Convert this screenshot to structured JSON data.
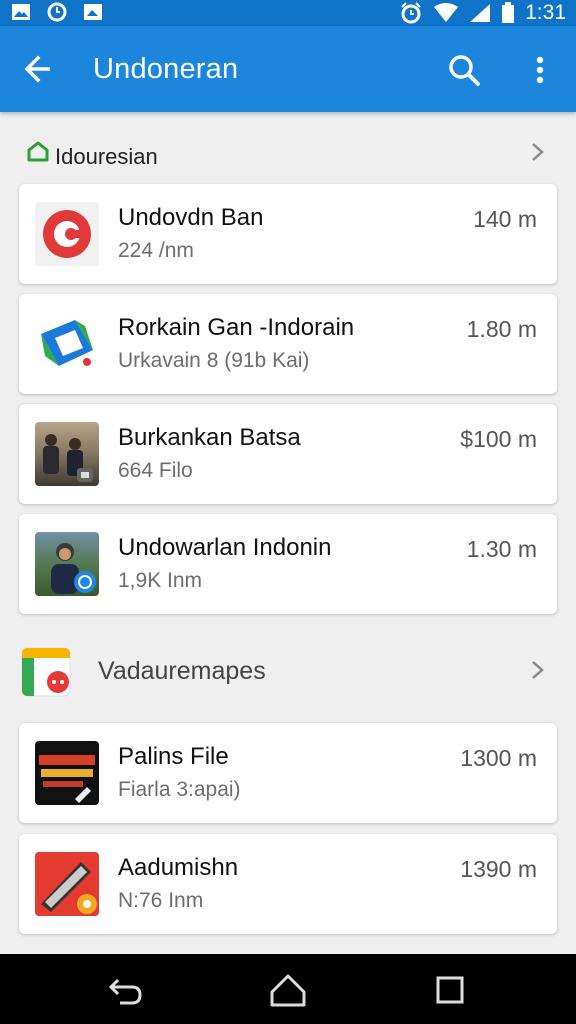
{
  "status_bar": {
    "time": "1:31",
    "left_icons": [
      "image-icon",
      "alarm-icon",
      "photo-icon"
    ],
    "right_icons": [
      "alarm-clock-icon",
      "wifi-icon",
      "signal-icon",
      "battery-icon"
    ]
  },
  "app_bar": {
    "title": "Undoneran",
    "back_icon": "arrow-back-icon",
    "search_icon": "search-icon",
    "more_icon": "more-vert-icon",
    "color": "#1b86dc"
  },
  "section1": {
    "label": "Idouresian",
    "icon": "home-icon"
  },
  "items": [
    {
      "title": "Undovdn Ban",
      "subtitle": "224 /nm",
      "distance": "140 m"
    },
    {
      "title": "Rorkain Gan -Indorain",
      "subtitle": "Urkavain 8 (91b Kai)",
      "distance": "1.80 m"
    },
    {
      "title": "Burkankan Batsa",
      "subtitle": "664 Filo",
      "distance": "$100 m"
    },
    {
      "title": "Undowarlan Indonin",
      "subtitle": "1,9K Inm",
      "distance": "1.30 m"
    }
  ],
  "section2": {
    "label": "Vadauremapes",
    "icon": "maps-icon"
  },
  "items2": [
    {
      "title": "Palins File",
      "subtitle": "Fiarla 3:apai)",
      "distance": "1300 m"
    },
    {
      "title": "Aadumishn",
      "subtitle": "N:76 Inm",
      "distance": "1390 m"
    }
  ],
  "nav_bar": {
    "icons": [
      "back-nav-icon",
      "home-nav-icon",
      "recents-nav-icon"
    ]
  }
}
